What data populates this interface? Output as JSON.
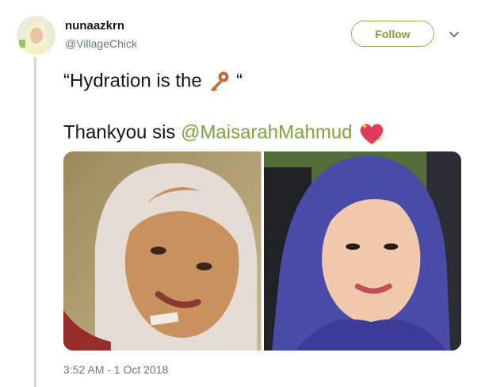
{
  "tweet": {
    "display_name": "nunaazkrn",
    "handle": "@VillageChick",
    "follow_label": "Follow",
    "line1_prefix": "“Hydration is the ",
    "line1_suffix": " “",
    "line2_prefix": "Thankyou sis ",
    "mention": "@MaisarahMahmud",
    "timestamp": "3:52 AM - 1 Oct 2018",
    "emojis": [
      "key-emoji",
      "sparkling-heart-emoji"
    ]
  },
  "colors": {
    "accent": "#7da33a",
    "thread_line": "#d2e2b8",
    "secondary_text": "#657786"
  },
  "media": {
    "photos": [
      "selfie-before",
      "selfie-after"
    ]
  }
}
